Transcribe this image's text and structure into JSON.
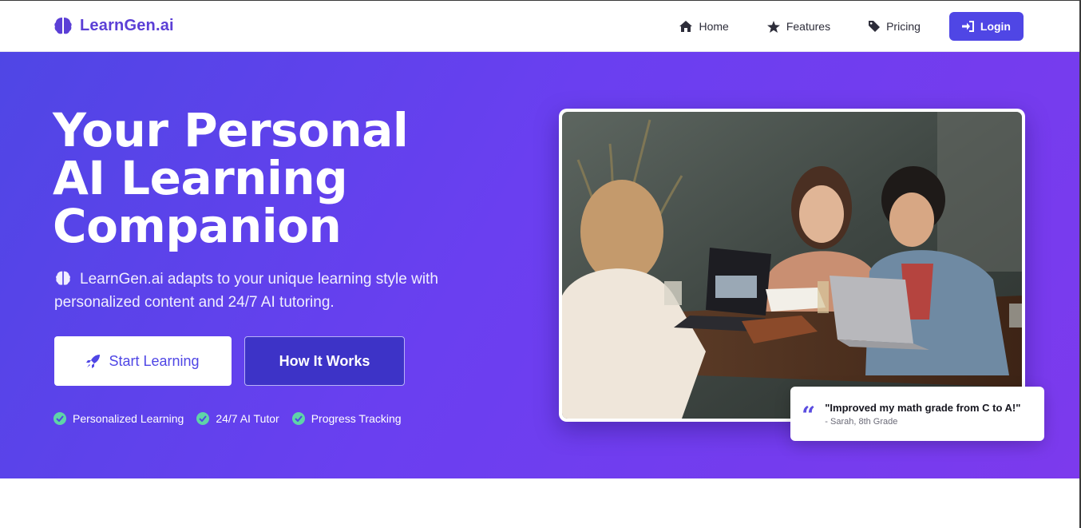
{
  "brand": {
    "name": "LearnGen.ai",
    "color": "#5b3fd6"
  },
  "nav": {
    "items": [
      {
        "label": "Home",
        "icon": "home-icon"
      },
      {
        "label": "Features",
        "icon": "star-icon"
      },
      {
        "label": "Pricing",
        "icon": "tag-icon"
      }
    ],
    "login_label": "Login",
    "login_icon": "sign-in-icon"
  },
  "hero": {
    "title_lines": [
      "Your Personal",
      "AI Learning",
      "Companion"
    ],
    "subtitle": "LearnGen.ai adapts to your unique learning style with personalized content and 24/7 AI tutoring.",
    "primary_button": "Start Learning",
    "secondary_button": "How It Works",
    "features": [
      "Personalized Learning",
      "24/7 AI Tutor",
      "Progress Tracking"
    ],
    "gradient_start": "#4f46e5",
    "gradient_end": "#7c3aed"
  },
  "testimonial": {
    "quote": "\"Improved my math grade from C to A!\"",
    "author": "- Sarah, 8th Grade"
  },
  "colors": {
    "accent": "#4f46e5",
    "check": "#5fd3a8"
  }
}
